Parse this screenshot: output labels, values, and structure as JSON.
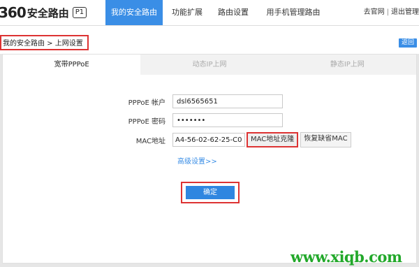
{
  "header": {
    "logo_mark": "360",
    "logo_text": "安全路由",
    "logo_badge": "P1",
    "nav": [
      {
        "label": "我的安全路由",
        "active": true
      },
      {
        "label": "功能扩展"
      },
      {
        "label": "路由设置"
      },
      {
        "label": "用手机管理路由"
      }
    ],
    "link_official": "去官网",
    "separator": "|",
    "link_logout": "退出管理"
  },
  "breadcrumb": {
    "text": "我的安全路由 > 上网设置",
    "back_label": "返回"
  },
  "tabs": [
    {
      "label": "宽带PPPoE",
      "active": true
    },
    {
      "label": "动态IP上网"
    },
    {
      "label": "静态IP上网"
    }
  ],
  "form": {
    "account_label": "PPPoE 帐户",
    "account_value": "dsl6565651",
    "password_label": "PPPoE 密码",
    "password_value": "•••••••",
    "mac_label": "MAC地址",
    "mac_value": "A4-56-02-62-25-C0",
    "mac_clone_label": "MAC地址克隆",
    "mac_restore_label": "恢复缺省MAC",
    "advanced_link": "高级设置>>",
    "confirm_label": "确定"
  },
  "watermark": "www.xiqb.com",
  "colors": {
    "accent": "#3a8ee6",
    "highlight": "#dd3333",
    "watermark": "#22a82a"
  }
}
